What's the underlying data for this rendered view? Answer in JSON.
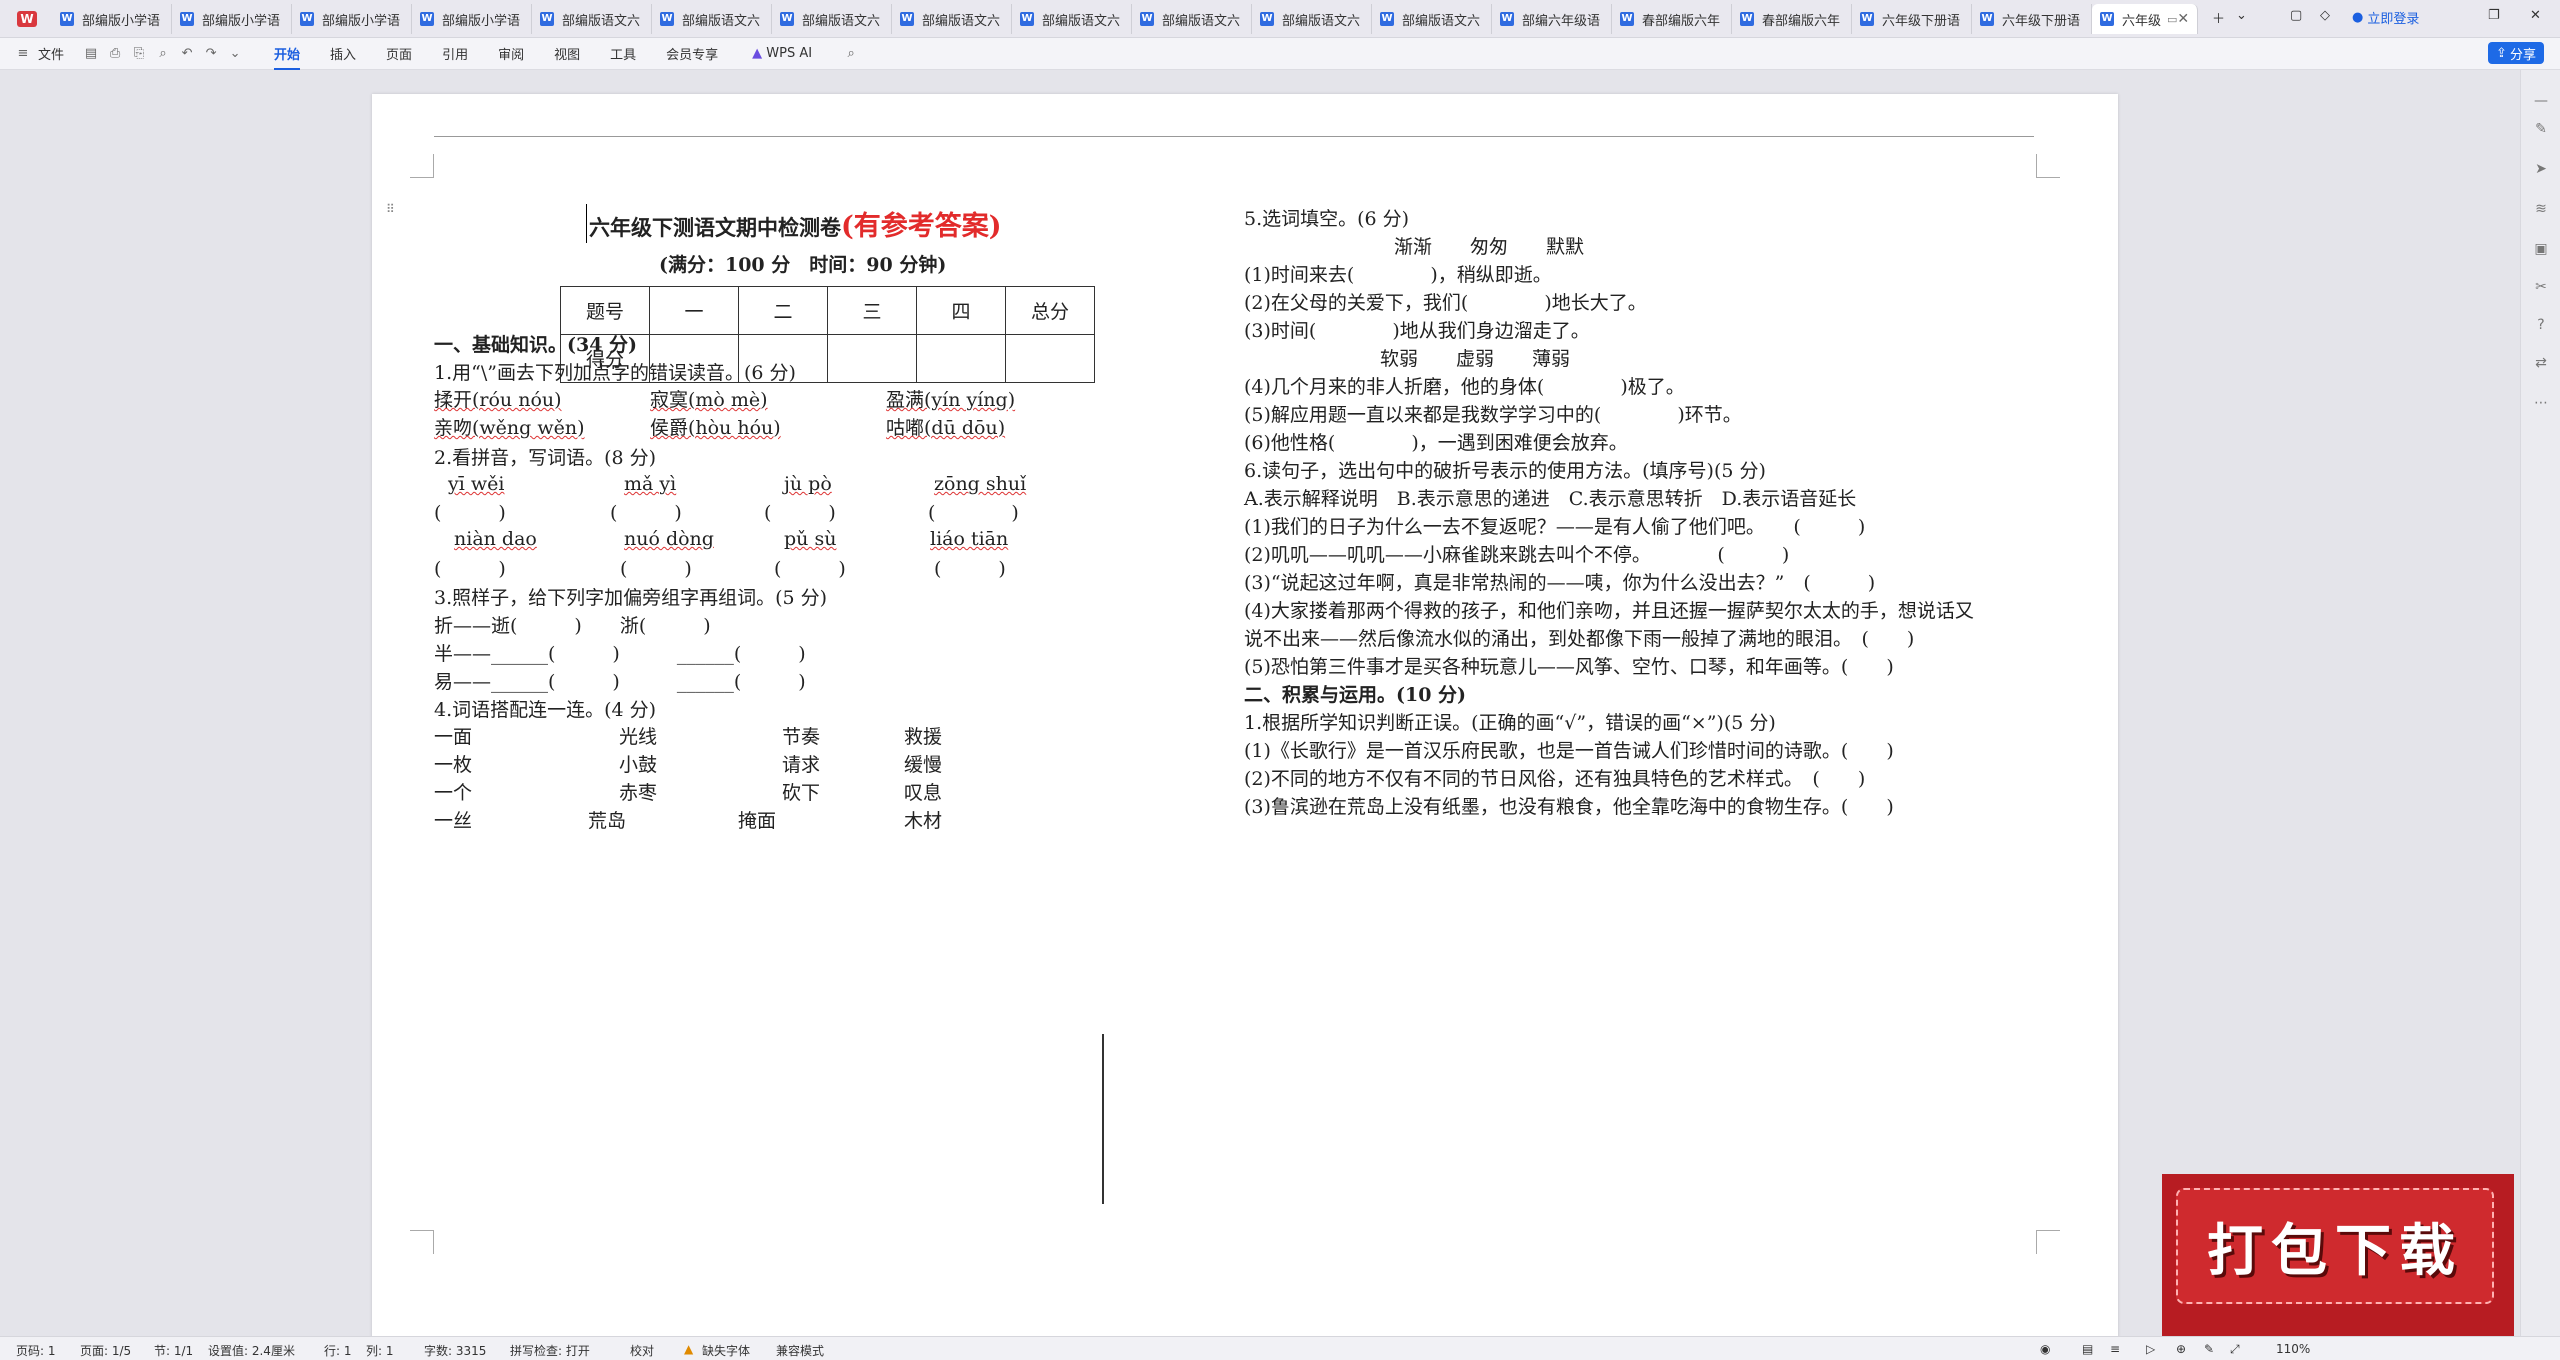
{
  "app": {
    "logo": "W"
  },
  "tabs": [
    "部编版小学语",
    "部编版小学语",
    "部编版小学语",
    "部编版小学语",
    "部编版语文六",
    "部编版语文六",
    "部编版语文六",
    "部编版语文六",
    "部编版语文六",
    "部编版语文六",
    "部编版语文六",
    "部编版语文六",
    "部编六年级语",
    "春部编版六年",
    "春部编版六年",
    "六年级下册语",
    "六年级下册语",
    "六年级"
  ],
  "topright": {
    "login": "立即登录"
  },
  "menu": {
    "file": "文件",
    "items": [
      "开始",
      "插入",
      "页面",
      "引用",
      "审阅",
      "视图",
      "工具",
      "会员专享"
    ],
    "wps_ai": "WPS AI",
    "share": "分享"
  },
  "doc": {
    "title": "六年级下测语文期中检测卷",
    "title_red": "(有参考答案)",
    "subtitle": "(满分：100 分　时间：90 分钟)",
    "score_table": {
      "row1": [
        "题号",
        "一",
        "二",
        "三",
        "四",
        "总分"
      ],
      "row2": [
        "得分",
        "",
        "",
        "",
        "",
        ""
      ]
    },
    "left": [
      "一、基础知识。(34 分)",
      "1.用“\\”画去下列加点字的错误读音。(6 分)",
      "揉开(róu nóu)",
      "寂寞(mò mè)",
      "盈满(yín yíng)",
      "亲吻(wěng wěn)",
      "侯爵(hòu hóu)",
      "咕嘟(dū dōu)",
      "2.看拼音，写词语。(8 分)",
      "yī wěi",
      "mǎ yì",
      "jù pò",
      "zōng shuǐ",
      "(　　　)",
      "(　　　)",
      "(　　　)",
      "(　　　　)",
      "niàn dao",
      "nuó dòng",
      "pǔ sù",
      "liáo tiān",
      "(　　　)",
      "(　　　)",
      "(　　　)",
      "(　　　)",
      "3.照样子，给下列字加偏旁组字再组词。(5 分)",
      "折——逝(　　　)　　浙(　　　)",
      "半——______(　　　)　　　______(　　　)",
      "易——______(　　　)　　　______(　　　)",
      "4.词语搭配连一连。(4 分)",
      "一面",
      "光线",
      "节奏",
      "救援",
      "一枚",
      "小鼓",
      "请求",
      "缓慢",
      "一个",
      "赤枣",
      "砍下",
      "叹息",
      "一丝",
      "荒岛",
      "掩面",
      "木材"
    ],
    "right": [
      "5.选词填空。(6 分)",
      "渐渐　　匆匆　　默默",
      "(1)时间来去(　　　　)，稍纵即逝。",
      "(2)在父母的关爱下，我们(　　　　)地长大了。",
      "(3)时间(　　　　)地从我们身边溜走了。",
      "软弱　　虚弱　　薄弱",
      "(4)几个月来的非人折磨，他的身体(　　　　)极了。",
      "(5)解应用题一直以来都是我数学学习中的(　　　　)环节。",
      "(6)他性格(　　　　)，一遇到困难便会放弃。",
      "6.读句子，选出句中的破折号表示的使用方法。(填序号)(5 分)",
      "A.表示解释说明　B.表示意思的递进　C.表示意思转折　D.表示语音延长",
      "(1)我们的日子为什么一去不复返呢？——是有人偷了他们吧。　　(　　　)",
      "(2)叽叽——叽叽——小麻雀跳来跳去叫个不停。　　　　(　　　)",
      "(3)“说起这过年啊，真是非常热闹的——咦，你为什么没出去？”　(　　　)",
      "(4)大家搂着那两个得救的孩子，和他们亲吻，并且还握一握萨契尔太太的手，想说话又",
      "说不出来——然后像流水似的涌出，到处都像下雨一般掉了满地的眼泪。　(　　)",
      "(5)恐怕第三件事才是买各种玩意儿——风筝、空竹、口琴，和年画等。(　　)",
      "二、积累与运用。(10 分)",
      "1.根据所学知识判断正误。(正确的画“√”，错误的画“×”)(5 分)",
      "(1)《长歌行》是一首汉乐府民歌，也是一首告诫人们珍惜时间的诗歌。(　　)",
      "(2)不同的地方不仅有不同的节日风俗，还有独具特色的艺术样式。　(　　)",
      "(3)鲁滨逊在荒岛上没有纸墨，也没有粮食，他全靠吃海中的食物生存。(　　)"
    ]
  },
  "status": {
    "page": "页码: 1",
    "pages": "页面: 1/5",
    "section": "节: 1/1",
    "setting": "设置值: 2.4厘米",
    "row": "行: 1",
    "col": "列: 1",
    "words": "字数: 3315",
    "spell": "拼写检查: 打开",
    "proof": "校对",
    "missing_font": "缺失字体",
    "compat": "兼容模式",
    "zoom": "110%"
  },
  "promo": {
    "text": "打包下载"
  }
}
